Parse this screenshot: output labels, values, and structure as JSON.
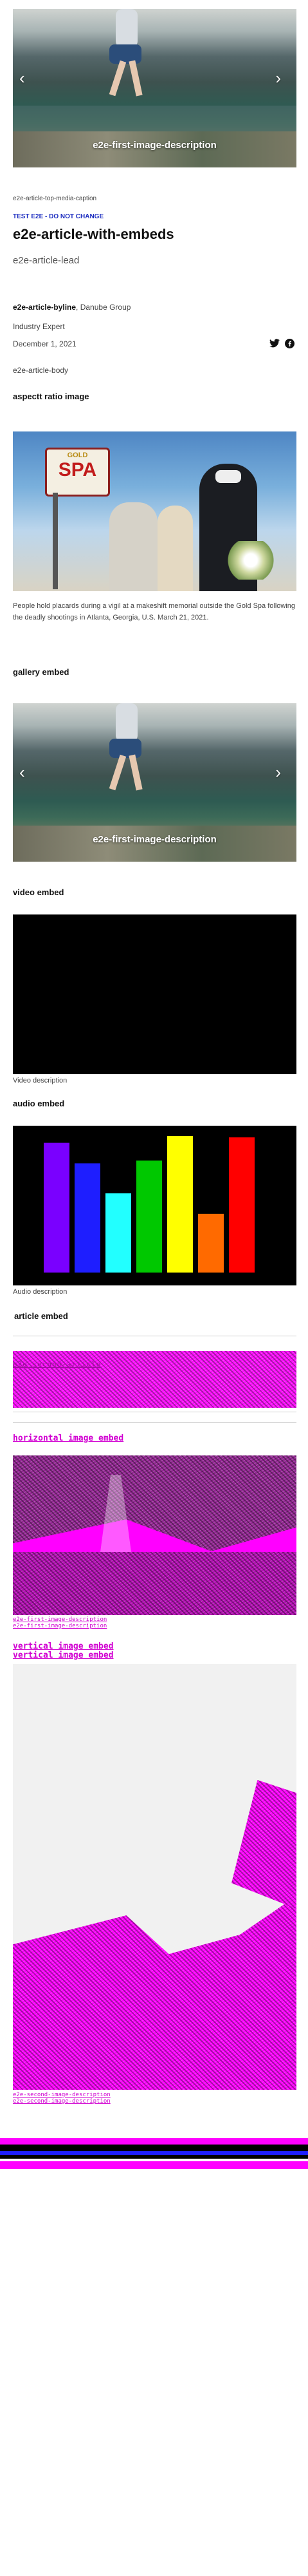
{
  "hero": {
    "caption": "e2e-first-image-description",
    "media_caption": "e2e-article-top-media-caption"
  },
  "article": {
    "kicker": "TEST E2E - DO NOT CHANGE",
    "title": "e2e-article-with-embeds",
    "lead": "e2e-article-lead",
    "byline_name": "e2e-article-byline",
    "byline_org": ", Danube Group",
    "byline_role": "Industry Expert",
    "date": "December 1, 2021",
    "body": "e2e-article-body"
  },
  "sections": {
    "aspect_ratio": "aspectt ratio image",
    "gallery": "gallery embed",
    "video": "video embed",
    "audio": "audio embed",
    "article": "article embed",
    "horizontal": "horizontal image embed",
    "vertical_1": "vertical image embed",
    "vertical_2": "vertical image embed"
  },
  "aspect_caption": "People hold placards during a vigil at a makeshift memorial outside the Gold Spa following the deadly shootings in Atlanta, Georgia, U.S. March 21, 2021.",
  "spa_sign": "SPA",
  "spa_sign_top": "GOLD",
  "gallery_caption": "e2e-first-image-description",
  "video_description": "Video description",
  "audio_description": "Audio description",
  "article_embed_glitch": "e2e-second-article",
  "horizontal_glitch_captions": [
    "e2e-first-image-description",
    "e2e-first-image-description"
  ],
  "vertical_glitch_captions": [
    "e2e-second-image-description",
    "e2e-second-image-description"
  ],
  "audio_bars": [
    {
      "color": "#7a00ff",
      "level": 0.95
    },
    {
      "color": "#1e1eff",
      "level": 0.8
    },
    {
      "color": "#22ffff",
      "level": 0.58
    },
    {
      "color": "#00c800",
      "level": 0.82
    },
    {
      "color": "#ffff00",
      "level": 1.0
    },
    {
      "color": "#ff6a00",
      "level": 0.43
    },
    {
      "color": "#ff0000",
      "level": 0.99
    }
  ],
  "icons": {
    "twitter": "twitter-icon",
    "facebook": "facebook-icon",
    "prev": "chevron-left-icon",
    "next": "chevron-right-icon"
  }
}
